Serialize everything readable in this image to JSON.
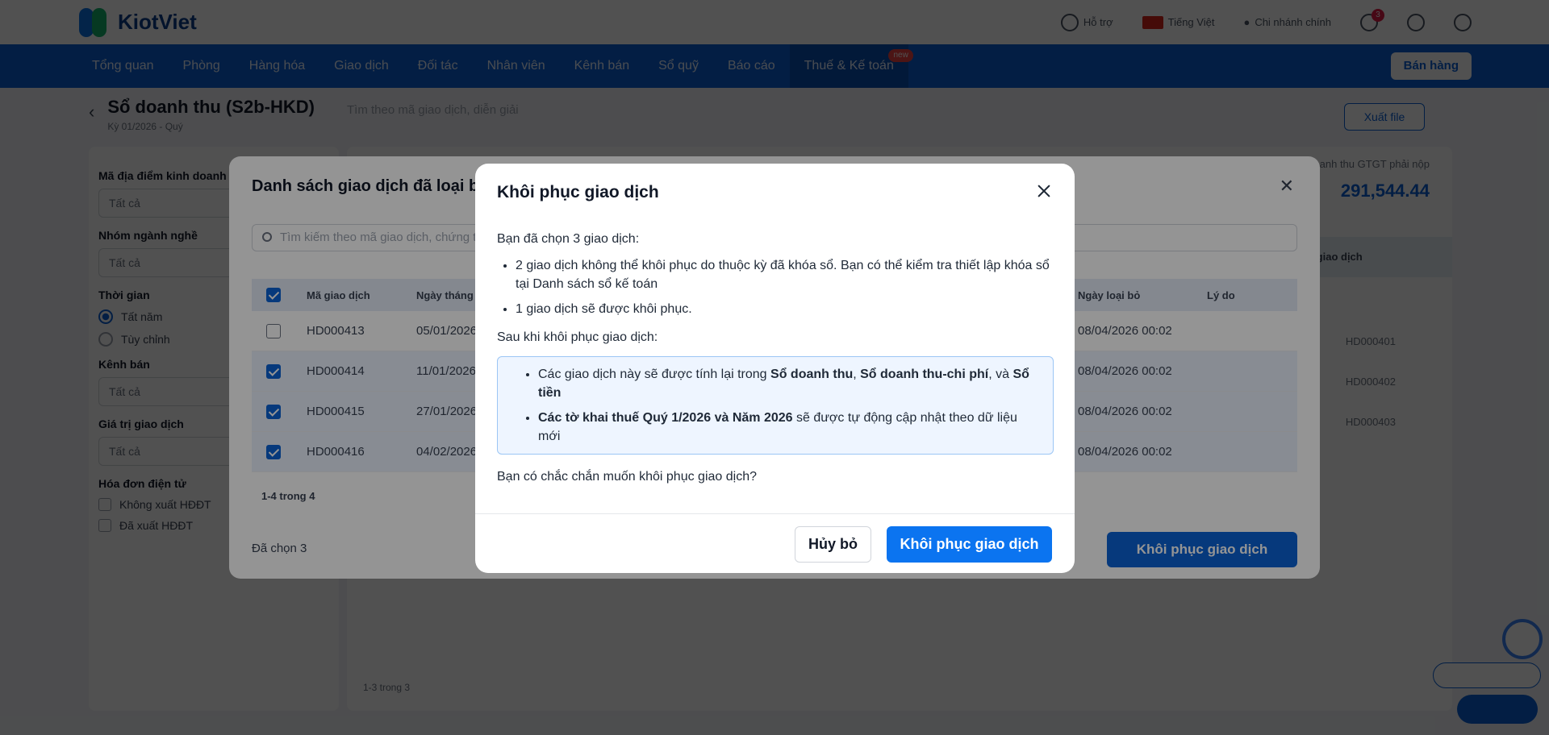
{
  "app": {
    "logo_text": "KiotViet"
  },
  "topbar": {
    "support": "Hỗ trợ",
    "language": "Tiếng Việt",
    "branch": "Chi nhánh chính",
    "notification_count": "3"
  },
  "nav": {
    "items": [
      "Tổng quan",
      "Phòng",
      "Hàng hóa",
      "Giao dịch",
      "Đối tác",
      "Nhân viên",
      "Kênh bán",
      "Sổ quỹ",
      "Báo cáo",
      "Thuế & Kế toán"
    ],
    "badge": "new",
    "sell_button": "Bán hàng"
  },
  "page": {
    "title": "Sổ doanh thu (S2b-HKD)",
    "subtitle": "Kỳ 01/2026 - Quý",
    "search_placeholder": "Tìm theo mã giao dịch, diễn giải",
    "export_label": "Xuất file",
    "total_label": "Tổng doanh thu GTGT phải nộp",
    "total_value": "291,544.44",
    "table_header": "Mã giao dịch",
    "cells": [
      "HD000401",
      "HD000402",
      "HD000403"
    ],
    "pagination": "1-3 trong 3"
  },
  "filters": {
    "location_label": "Mã địa điểm kinh doanh",
    "location_value": "Tất cả",
    "industry_label": "Nhóm ngành nghề",
    "industry_value": "Tất cả",
    "time_label": "Thời gian",
    "time_option1": "Tất năm",
    "time_option2": "Tùy chỉnh",
    "channel_label": "Kênh bán",
    "channel_value": "Tất cả",
    "value_label": "Giá trị giao dịch",
    "value_value": "Tất cả",
    "invoice_label": "Hóa đơn điện tử",
    "invoice_opt1": "Không xuất HĐĐT",
    "invoice_opt2": "Đã xuất HĐĐT"
  },
  "list_modal": {
    "title": "Danh sách giao dịch đã loại bỏ",
    "search_placeholder": "Tìm kiếm theo mã giao dịch, chứng từ",
    "columns": {
      "code": "Mã giao dịch",
      "date": "Ngày tháng",
      "removed_date": "Ngày loại bỏ",
      "reason": "Lý do"
    },
    "rows": [
      {
        "code": "HD000413",
        "date": "05/01/2026",
        "removed": "08/04/2026 00:02",
        "selected": false
      },
      {
        "code": "HD000414",
        "date": "11/01/2026",
        "removed": "08/04/2026 00:02",
        "selected": true
      },
      {
        "code": "HD000415",
        "date": "27/01/2026",
        "removed": "08/04/2026 00:02",
        "selected": true
      },
      {
        "code": "HD000416",
        "date": "04/02/2026",
        "removed": "08/04/2026 00:02",
        "selected": true
      }
    ],
    "pagination": "1-4 trong 4",
    "selected_count": "Đã chọn 3",
    "restore_button": "Khôi phục giao dịch"
  },
  "dialog": {
    "title": "Khôi phục giao dịch",
    "intro": "Bạn đã chọn 3 giao dịch:",
    "bullet1": "2 giao dịch không thể khôi phục do thuộc kỳ đã khóa sổ. Bạn có thể kiểm tra thiết lập khóa sổ tại Danh sách sổ kế toán",
    "bullet2": "1 giao dịch sẽ được khôi phục.",
    "after_heading": "Sau khi khôi phục giao dịch:",
    "info1_prefix": "Các giao dịch này sẽ được tính lại trong ",
    "info1_b1": "Sổ doanh thu",
    "info1_sep1": ", ",
    "info1_b2": "Sổ doanh thu-chi phí",
    "info1_sep2": ", và ",
    "info1_b3": "Sổ tiền",
    "info2_bold": "Các tờ khai thuế Quý 1/2026 và Năm 2026",
    "info2_rest": " sẽ được tự động cập nhật theo dữ liệu mới",
    "question": "Bạn có chắc chắn muốn khôi phục giao dịch?",
    "cancel_label": "Hủy bỏ",
    "confirm_label": "Khôi phục giao dịch"
  },
  "colors": {
    "primary": "#0b74f0",
    "nav_bg": "#0b62d6",
    "info_bg": "#eef5ff",
    "info_border": "#9cc6f5"
  }
}
